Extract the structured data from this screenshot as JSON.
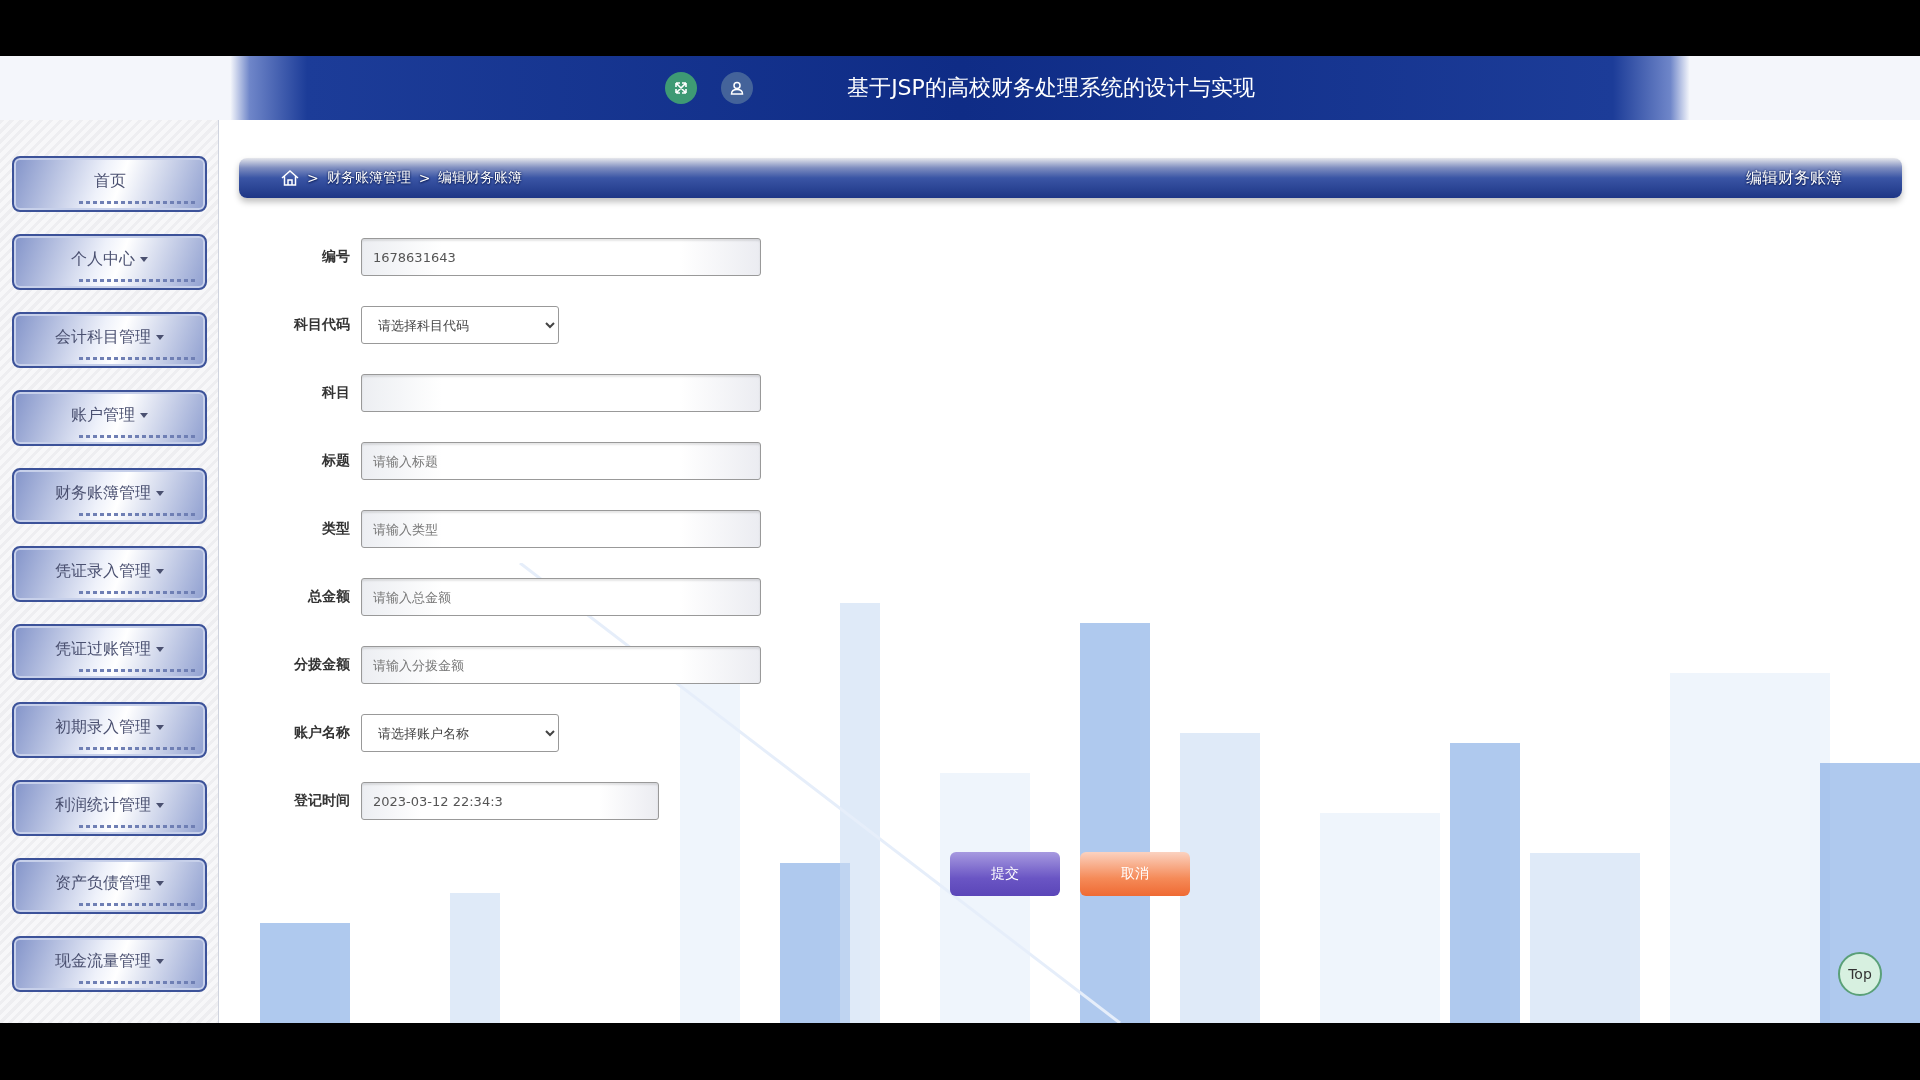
{
  "header": {
    "title": "基于JSP的高校财务处理系统的设计与实现"
  },
  "sidebar": {
    "items": [
      {
        "label": "首页",
        "dropdown": false
      },
      {
        "label": "个人中心",
        "dropdown": true
      },
      {
        "label": "会计科目管理",
        "dropdown": true
      },
      {
        "label": "账户管理",
        "dropdown": true
      },
      {
        "label": "财务账簿管理",
        "dropdown": true
      },
      {
        "label": "凭证录入管理",
        "dropdown": true
      },
      {
        "label": "凭证过账管理",
        "dropdown": true
      },
      {
        "label": "初期录入管理",
        "dropdown": true
      },
      {
        "label": "利润统计管理",
        "dropdown": true
      },
      {
        "label": "资产负债管理",
        "dropdown": true
      },
      {
        "label": "现金流量管理",
        "dropdown": true
      }
    ]
  },
  "breadcrumb": {
    "separator": ">",
    "items": [
      "财务账簿管理",
      "编辑财务账簿"
    ],
    "page_title": "编辑财务账簿"
  },
  "form": {
    "fields": [
      {
        "label": "编号",
        "kind": "text",
        "value": "1678631643"
      },
      {
        "label": "科目代码",
        "kind": "select",
        "value": "请选择科目代码"
      },
      {
        "label": "科目",
        "kind": "text"
      },
      {
        "label": "标题",
        "kind": "text",
        "placeholder": "请输入标题"
      },
      {
        "label": "类型",
        "kind": "text",
        "placeholder": "请输入类型"
      },
      {
        "label": "总金额",
        "kind": "text",
        "placeholder": "请输入总金额"
      },
      {
        "label": "分拨金额",
        "kind": "text",
        "placeholder": "请输入分拨金额"
      },
      {
        "label": "账户名称",
        "kind": "select",
        "value": "请选择账户名称"
      },
      {
        "label": "登记时间",
        "kind": "date",
        "value": "2023-03-12 22:34:3"
      }
    ],
    "buttons": [
      {
        "label": "提交",
        "kind": "submit"
      },
      {
        "label": "取消",
        "kind": "cancel"
      }
    ]
  },
  "top_button": "Top"
}
